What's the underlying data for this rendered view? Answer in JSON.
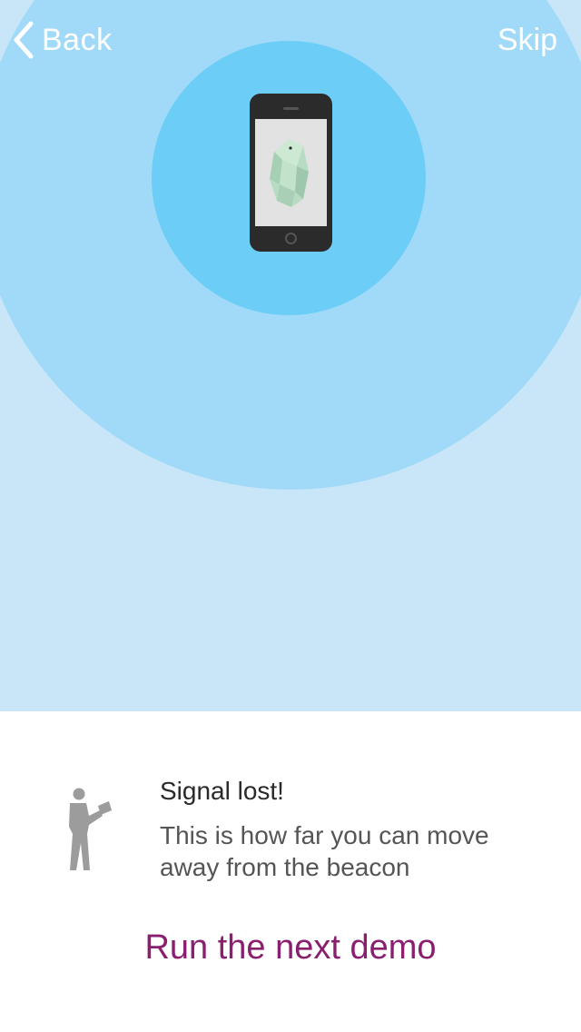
{
  "nav": {
    "back_label": "Back",
    "skip_label": "Skip"
  },
  "message": {
    "title": "Signal lost!",
    "body": "This is how far you can move away from the beacon"
  },
  "cta": {
    "label": "Run the next demo"
  },
  "colors": {
    "background_far": "#c8e6f8",
    "range_outer": "#a1daf8",
    "range_inner": "#6ccef6",
    "accent": "#8a1f6f"
  },
  "icons": {
    "back": "chevron-left-icon",
    "phone": "phone-icon",
    "beacon": "beacon-icon",
    "person": "person-walking-icon"
  }
}
